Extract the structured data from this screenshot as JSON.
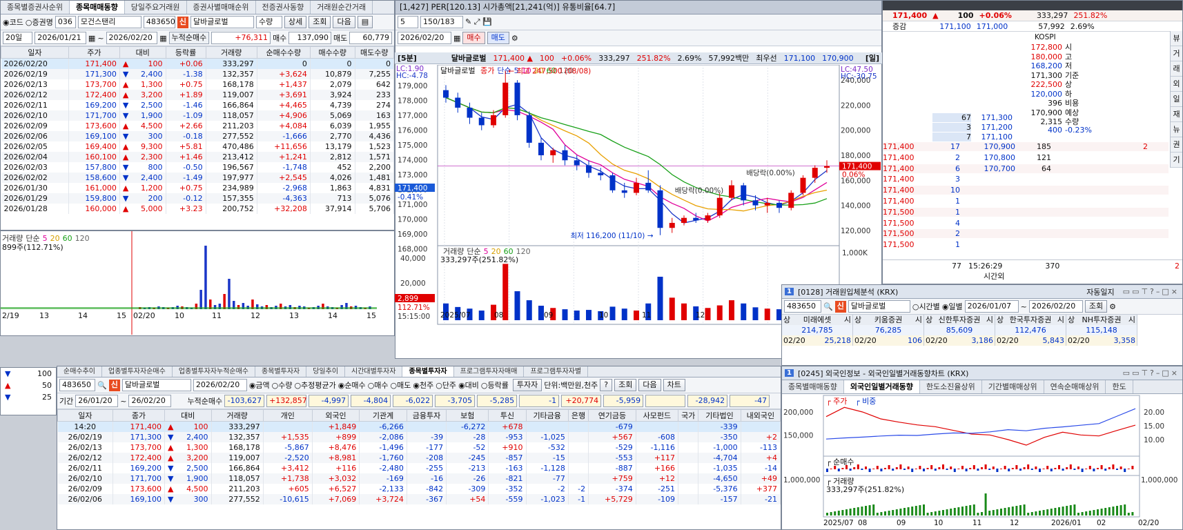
{
  "stock": {
    "code": "483650",
    "name": "달바글로벌",
    "broker_code": "036",
    "broker_name": "모건스탠리",
    "price": "171,400",
    "change": "100",
    "rate": "+0.06%",
    "volume": "333,297",
    "vol_ratio": "251.82%",
    "turnover": "2.69%",
    "amount": "57,992백만",
    "best_label": "최우선",
    "best_ask": "171,100",
    "best_bid": "170,900",
    "ticker_strip": "[1,427]  PER[120.13]  시가총액[21,241(억)]  유통비율[64.7]"
  },
  "left": {
    "tabs": [
      "종목별증권사순위",
      "종목매매동향",
      "당일주요거래원",
      "증권사별매매순위",
      "전증권사동향",
      "거래원순간거래"
    ],
    "active_tab": 1,
    "radio_code": "코드",
    "radio_broker": "증권명",
    "qty_label": "수량",
    "detail_btn": "상세",
    "query_btn": "조회",
    "next_btn": "다음",
    "period": "20일",
    "from": "2026/01/21",
    "to": "2026/02/20",
    "cum_label": "누적순매수",
    "cum_value": "+76,311",
    "buy_label": "매수",
    "buy_value": "137,090",
    "sell_label": "매도",
    "sell_value": "60,779",
    "headers": [
      "일자",
      "주가",
      "대비",
      "등락률",
      "거래량",
      "순매수수량",
      "매수수량",
      "매도수량"
    ],
    "rows": [
      [
        "2026/02/20",
        "171,400",
        "▲",
        "100",
        "+0.06",
        "333,297",
        "0",
        "0",
        "0"
      ],
      [
        "2026/02/19",
        "171,300",
        "▼",
        "2,400",
        "-1.38",
        "132,357",
        "+3,624",
        "10,879",
        "7,255"
      ],
      [
        "2026/02/13",
        "173,700",
        "▲",
        "1,300",
        "+0.75",
        "168,178",
        "+1,437",
        "2,079",
        "642"
      ],
      [
        "2026/02/12",
        "172,400",
        "▲",
        "3,200",
        "+1.89",
        "119,007",
        "+3,691",
        "3,924",
        "233"
      ],
      [
        "2026/02/11",
        "169,200",
        "▼",
        "2,500",
        "-1.46",
        "166,864",
        "+4,465",
        "4,739",
        "274"
      ],
      [
        "2026/02/10",
        "171,700",
        "▼",
        "1,900",
        "-1.09",
        "118,057",
        "+4,906",
        "5,069",
        "163"
      ],
      [
        "2026/02/09",
        "173,600",
        "▲",
        "4,500",
        "+2.66",
        "211,203",
        "+4,084",
        "6,039",
        "1,955"
      ],
      [
        "2026/02/06",
        "169,100",
        "▼",
        "300",
        "-0.18",
        "277,552",
        "-1,666",
        "2,770",
        "4,436"
      ],
      [
        "2026/02/05",
        "169,400",
        "▲",
        "9,300",
        "+5.81",
        "470,486",
        "+11,656",
        "13,179",
        "1,523"
      ],
      [
        "2026/02/04",
        "160,100",
        "▲",
        "2,300",
        "+1.46",
        "213,412",
        "+1,241",
        "2,812",
        "1,571"
      ],
      [
        "2026/02/03",
        "157,800",
        "▼",
        "800",
        "-0.50",
        "196,567",
        "-1,748",
        "452",
        "2,200"
      ],
      [
        "2026/02/02",
        "158,600",
        "▼",
        "2,400",
        "-1.49",
        "197,977",
        "+2,545",
        "4,026",
        "1,481"
      ],
      [
        "2026/01/30",
        "161,000",
        "▲",
        "1,200",
        "+0.75",
        "234,989",
        "-2,968",
        "1,863",
        "4,831"
      ],
      [
        "2026/01/29",
        "159,800",
        "▼",
        "200",
        "-0.12",
        "157,355",
        "-4,363",
        "713",
        "5,076"
      ],
      [
        "2026/01/28",
        "160,000",
        "▲",
        "5,000",
        "+3.23",
        "200,752",
        "+32,208",
        "37,914",
        "5,706"
      ]
    ],
    "vol_legend": [
      "거래량",
      "단순",
      "5",
      "20",
      "60",
      "120"
    ],
    "vol_value": "899주(112.71%)",
    "x_labels": [
      "2/19",
      "13",
      "14",
      "15",
      "02/20",
      "10",
      "11",
      "12",
      "13",
      "14",
      "15"
    ]
  },
  "mid": {
    "spin": "5",
    "count": "150/183",
    "frame_label": "[5분]",
    "day_label": "[일]",
    "date": "2026/02/20",
    "buy_btn": "매수",
    "sell_btn": "매도",
    "left_axis": [
      "179,000",
      "178,000",
      "177,000",
      "176,000",
      "175,000",
      "174,000",
      "173,000",
      "172,000",
      "171,000",
      "170,000",
      "169,000",
      "168,000"
    ],
    "lc_label": "LC:1.90",
    "hc_label": "HC:-4.78",
    "price_tag": "171,400",
    "price_tag_rate": "-0.41%",
    "vol_axis": [
      "40,000",
      "20,000"
    ],
    "vol_tag": "2,899",
    "vol_tag_rate": "112.71%",
    "time_label": "15:15:00"
  },
  "daily": {
    "legend_prefix": "달바글로벌",
    "legend_items": [
      "종가",
      "단순",
      "5",
      "10",
      "20",
      "60",
      "120"
    ],
    "high_note": "최고 247,500 (08/08)",
    "low_note": "최저 116,200 (11/10)",
    "div_note1": "배당락(0.00%)",
    "div_note2": "배당락(0.00%)",
    "right_axis": [
      "240,000",
      "220,000",
      "200,000",
      "180,000",
      "160,000",
      "140,000",
      "120,000"
    ],
    "lc": "LC:47.50",
    "hc": "HC:-30.75",
    "tag_price": "171,400",
    "tag_rate": "0.06%",
    "vol_legend": [
      "거래량",
      "단순",
      "5",
      "20",
      "60",
      "120"
    ],
    "vol_value": "333,297주(251.82%)",
    "vol_axis": "1,000K",
    "x_labels": [
      "2025/07",
      "08",
      "09",
      "10",
      "11",
      "12"
    ],
    "candles": [
      {
        "d": 0,
        "o": 232000,
        "h": 236000,
        "l": 222000,
        "c": 226000
      },
      {
        "d": 1,
        "o": 226000,
        "h": 230000,
        "l": 214000,
        "c": 218000
      },
      {
        "d": 2,
        "o": 218000,
        "h": 222000,
        "l": 205000,
        "c": 210000
      },
      {
        "d": 3,
        "o": 210000,
        "h": 214000,
        "l": 200000,
        "c": 204000
      },
      {
        "d": 4,
        "o": 204000,
        "h": 216000,
        "l": 202000,
        "c": 212000
      },
      {
        "d": 5,
        "o": 212000,
        "h": 247500,
        "l": 210000,
        "c": 238000
      },
      {
        "d": 6,
        "o": 238000,
        "h": 240000,
        "l": 208000,
        "c": 212000
      },
      {
        "d": 7,
        "o": 212000,
        "h": 215000,
        "l": 186000,
        "c": 190000
      },
      {
        "d": 8,
        "o": 190000,
        "h": 194000,
        "l": 176000,
        "c": 180000
      },
      {
        "d": 9,
        "o": 180000,
        "h": 186000,
        "l": 174000,
        "c": 184000
      },
      {
        "d": 10,
        "o": 184000,
        "h": 188000,
        "l": 172000,
        "c": 176000
      },
      {
        "d": 11,
        "o": 176000,
        "h": 180000,
        "l": 168000,
        "c": 172000
      },
      {
        "d": 12,
        "o": 172000,
        "h": 176000,
        "l": 162000,
        "c": 166000
      },
      {
        "d": 13,
        "o": 166000,
        "h": 170000,
        "l": 160000,
        "c": 164000
      },
      {
        "d": 14,
        "o": 164000,
        "h": 166000,
        "l": 150000,
        "c": 152000
      },
      {
        "d": 15,
        "o": 152000,
        "h": 158000,
        "l": 146000,
        "c": 150000
      },
      {
        "d": 16,
        "o": 150000,
        "h": 162000,
        "l": 148000,
        "c": 158000
      },
      {
        "d": 17,
        "o": 158000,
        "h": 168000,
        "l": 150000,
        "c": 152000
      },
      {
        "d": 18,
        "o": 152000,
        "h": 156000,
        "l": 116200,
        "c": 122000
      },
      {
        "d": 19,
        "o": 122000,
        "h": 130000,
        "l": 118000,
        "c": 126000
      },
      {
        "d": 20,
        "o": 126000,
        "h": 132000,
        "l": 124000,
        "c": 130000
      },
      {
        "d": 21,
        "o": 130000,
        "h": 134000,
        "l": 126000,
        "c": 128000
      },
      {
        "d": 22,
        "o": 128000,
        "h": 134000,
        "l": 126000,
        "c": 132000
      },
      {
        "d": 23,
        "o": 132000,
        "h": 150000,
        "l": 130000,
        "c": 146000
      },
      {
        "d": 24,
        "o": 146000,
        "h": 160000,
        "l": 144000,
        "c": 156000
      },
      {
        "d": 25,
        "o": 156000,
        "h": 158000,
        "l": 140000,
        "c": 144000
      },
      {
        "d": 26,
        "o": 144000,
        "h": 148000,
        "l": 136000,
        "c": 140000
      },
      {
        "d": 27,
        "o": 140000,
        "h": 146000,
        "l": 134000,
        "c": 142000
      },
      {
        "d": 28,
        "o": 142000,
        "h": 144000,
        "l": 134000,
        "c": 138000
      },
      {
        "d": 29,
        "o": 138000,
        "h": 152000,
        "l": 136000,
        "c": 150000
      },
      {
        "d": 30,
        "o": 150000,
        "h": 164000,
        "l": 148000,
        "c": 162000
      },
      {
        "d": 31,
        "o": 162000,
        "h": 172000,
        "l": 158000,
        "c": 170000
      },
      {
        "d": 32,
        "o": 170000,
        "h": 176000,
        "l": 166000,
        "c": 171400
      }
    ],
    "volumes": [
      520,
      410,
      360,
      300,
      480,
      1750,
      900,
      620,
      450,
      380,
      340,
      300,
      320,
      280,
      420,
      360,
      300,
      520,
      1350,
      700,
      520,
      430,
      380,
      460,
      620,
      520,
      400,
      360,
      340,
      420,
      520,
      480,
      333
    ]
  },
  "orderbook": {
    "price": "171,400",
    "change": "100",
    "rate": "+0.06%",
    "volume": "333,297",
    "vol_ratio": "251.82%",
    "label_change": "증감",
    "ask1": "171,100",
    "bid1": "171,000",
    "amount": "57,992",
    "turnover": "2.69%",
    "kospi": "KOSPI",
    "info": [
      [
        "172,800",
        "시"
      ],
      [
        "180,000",
        "고"
      ],
      [
        "168,200",
        "저"
      ],
      [
        "171,300",
        "기준"
      ],
      [
        "222,500",
        "상"
      ],
      [
        "120,000",
        "하"
      ],
      [
        "396",
        "비용"
      ],
      [
        "170,900",
        "예상"
      ],
      [
        "2,315",
        "수량"
      ],
      [
        "400",
        "-0.23%"
      ]
    ],
    "ask_rows": [
      [
        "67",
        "171,300"
      ],
      [
        "3",
        "171,200"
      ],
      [
        "7",
        "171,100"
      ]
    ],
    "bid_rows": [
      [
        "171,400",
        "17",
        "170,900",
        "185",
        "2"
      ],
      [
        "171,400",
        "2",
        "170,800",
        "121",
        ""
      ],
      [
        "171,400",
        "6",
        "170,700",
        "64",
        ""
      ],
      [
        "171,400",
        "3",
        "",
        "",
        ""
      ],
      [
        "171,400",
        "10",
        "",
        "",
        ""
      ],
      [
        "171,400",
        "1",
        "",
        "",
        ""
      ],
      [
        "171,500",
        "1",
        "",
        "",
        ""
      ],
      [
        "171,500",
        "4",
        "",
        "",
        ""
      ],
      [
        "171,500",
        "2",
        "",
        "",
        ""
      ],
      [
        "171,500",
        "1",
        "",
        "",
        ""
      ]
    ],
    "footer_left": "77",
    "footer_time": "15:26:29",
    "footer_right": "370",
    "footer_right2": "2",
    "footer_label": "시간외",
    "side_tabs": [
      "뷰",
      "거",
      "래",
      "외",
      "일",
      "재",
      "뉴",
      "권",
      "기"
    ]
  },
  "bottom": {
    "tabs": [
      "순매수추이",
      "업종별투자자순매수",
      "업종별투자자누적순매수",
      "종목별투자자",
      "당일추이",
      "시간대별투자자",
      "종목별투자자",
      "프로그램투자자매매",
      "프로그램투자자별"
    ],
    "code": "483650",
    "name": "달바글로벌",
    "date": "2026/02/20",
    "opts": [
      "금액",
      "수량",
      "추정평균가",
      "순매수",
      "매수",
      "매도",
      "천주",
      "단주",
      "대비",
      "등락률"
    ],
    "investor_btn": "투자자",
    "unit": "단위:백만원,천주",
    "help": "?",
    "query": "조회",
    "next": "다음",
    "chart": "차트",
    "period_label": "기간",
    "from": "26/01/20",
    "to": "26/02/20",
    "cum_label": "누적순매수",
    "cum_values": [
      "-103,627",
      "+132,857",
      "-4,997",
      "-4,804",
      "-6,022",
      "-3,705",
      "-5,285",
      "-1",
      "+20,774",
      "-5,959",
      "",
      "-28,942",
      "-47"
    ],
    "headers": [
      "일자",
      "종가",
      "대비",
      "거래량",
      "개인",
      "외국인",
      "기관계",
      "금융투자",
      "보험",
      "투신",
      "기타금융",
      "은행",
      "연기금등",
      "사모펀드",
      "국가",
      "기타법인",
      "내외국인"
    ],
    "rows": [
      [
        "14:20",
        "171,400",
        "▲",
        "100",
        "333,297",
        "",
        "+1,849",
        "-6,266",
        "",
        "-6,272",
        "+678",
        "",
        "",
        "-679",
        "",
        "",
        "-339",
        ""
      ],
      [
        "26/02/19",
        "171,300",
        "▼",
        "2,400",
        "132,357",
        "+1,535",
        "+899",
        "-2,086",
        "-39",
        "-28",
        "-953",
        "-1,025",
        "",
        "+567",
        "-608",
        "",
        "-350",
        "+2"
      ],
      [
        "26/02/13",
        "173,700",
        "▲",
        "1,300",
        "168,178",
        "-5,867",
        "+8,476",
        "-1,496",
        "-177",
        "-52",
        "+910",
        "-532",
        "",
        "-529",
        "-1,116",
        "",
        "-1,000",
        "-113"
      ],
      [
        "26/02/12",
        "172,400",
        "▲",
        "3,200",
        "119,007",
        "-2,520",
        "+8,981",
        "-1,760",
        "-208",
        "-245",
        "-857",
        "-15",
        "",
        "-553",
        "+117",
        "",
        "-4,704",
        "+4"
      ],
      [
        "26/02/11",
        "169,200",
        "▼",
        "2,500",
        "166,864",
        "+3,412",
        "+116",
        "-2,480",
        "-255",
        "-213",
        "-163",
        "-1,128",
        "",
        "-887",
        "+166",
        "",
        "-1,035",
        "-14"
      ],
      [
        "26/02/10",
        "171,700",
        "▼",
        "1,900",
        "118,057",
        "+1,738",
        "+3,032",
        "-169",
        "-16",
        "-26",
        "-821",
        "-77",
        "",
        "+759",
        "+12",
        "",
        "-4,650",
        "+49"
      ],
      [
        "26/02/09",
        "173,600",
        "▲",
        "4,500",
        "211,203",
        "+605",
        "+6,527",
        "-2,133",
        "-842",
        "-309",
        "-352",
        "-2",
        "-2",
        "-374",
        "-251",
        "",
        "-5,376",
        "+377"
      ],
      [
        "26/02/06",
        "169,100",
        "▼",
        "300",
        "277,552",
        "-10,615",
        "+7,069",
        "+3,724",
        "-367",
        "+54",
        "-559",
        "-1,023",
        "-1",
        "+5,729",
        "-109",
        "",
        "-157",
        "-21"
      ]
    ],
    "left_rows": [
      [
        "▼",
        "100"
      ],
      [
        "▲",
        "50"
      ],
      [
        "▼",
        "25"
      ]
    ]
  },
  "broker_win": {
    "title": "[0128] 거래원입체분석 (KRX)",
    "controls": "자동일지",
    "code": "483650",
    "name": "달바글로벌",
    "radio_time": "시간별",
    "radio_day": "일별",
    "from": "2026/01/07",
    "to": "2026/02/20",
    "query": "조회",
    "brokers": [
      {
        "name": "미래에셋",
        "total": "214,785",
        "date": "02/20",
        "v": "25,218"
      },
      {
        "name": "키움증권",
        "total": "76,285",
        "date": "02/20",
        "v": "106"
      },
      {
        "name": "신한투자증권",
        "total": "85,609",
        "date": "02/20",
        "v": "3,186"
      },
      {
        "name": "한국투자증권",
        "total": "112,476",
        "date": "02/20",
        "v": "5,843"
      },
      {
        "name": "NH투자증권",
        "total": "115,148",
        "date": "02/20",
        "v": "3,358"
      }
    ],
    "sang": "상",
    "si": "시"
  },
  "foreign_win": {
    "title": "[0245] 외국인정보 - 외국인일별거래동향차트 (KRX)",
    "tabs": [
      "종목별매매동향",
      "외국인일별거래동향",
      "한도소진율상위",
      "기간별매매상위",
      "연속순매매상위",
      "한도"
    ],
    "active": 1,
    "legend_price": "주가",
    "legend_ratio": "비중",
    "left_axis": [
      "200,000",
      "150,000"
    ],
    "right_axis": [
      "20.00",
      "15.00",
      "10.00"
    ],
    "net_label": "순매수",
    "vol_label": "거래량",
    "vol_axis": "1,000,000",
    "vol_value": "333,297주(251.82%)",
    "x_labels": [
      "2025/07",
      "08",
      "09",
      "10",
      "11",
      "12",
      "2026/01",
      "02",
      "02/20"
    ],
    "price_series": [
      190000,
      210000,
      200000,
      185000,
      178000,
      172000,
      168000,
      160000,
      152000,
      150000,
      140000,
      128000,
      145000,
      156000,
      150000,
      148000,
      160000,
      171400
    ],
    "ratio_series": [
      10.2,
      10.6,
      10.9,
      11.3,
      11.6,
      11.5,
      12.0,
      12.4,
      12.3,
      12.8,
      13.6,
      13.2,
      14.1,
      14.6,
      15.2,
      15.8,
      18.5,
      21.2
    ]
  },
  "colors": {
    "up": "#e00000",
    "down": "#0032c8",
    "accent": "#e84b20"
  }
}
